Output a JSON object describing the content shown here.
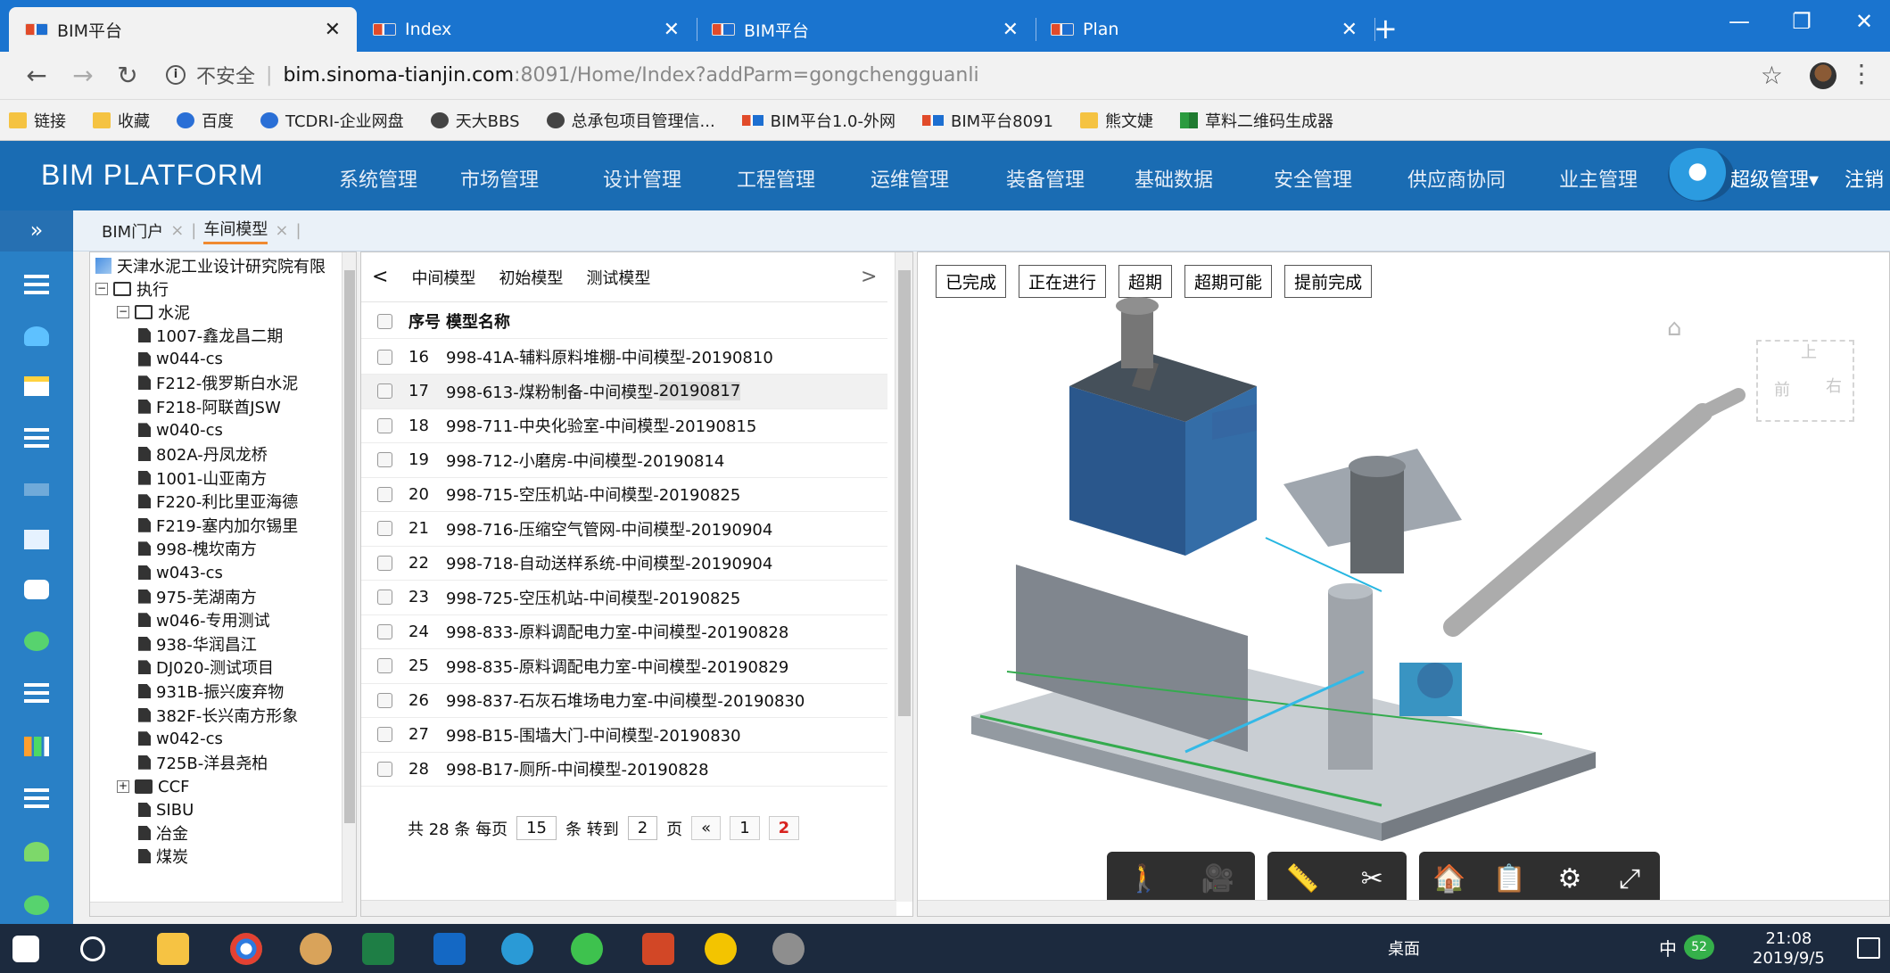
{
  "browser": {
    "tabs": [
      {
        "label": "BIM平台",
        "active": true
      },
      {
        "label": "Index",
        "active": false
      },
      {
        "label": "BIM平台",
        "active": false
      },
      {
        "label": "Plan",
        "active": false
      }
    ],
    "new_tab": "+",
    "window_controls": [
      "—",
      "❐",
      "✕"
    ],
    "address": {
      "security": "不安全",
      "host": "bim.sinoma-tianjin.com",
      "path": ":8091/Home/Index?addParm=gongchengguanli"
    },
    "bookmarks": [
      {
        "label": "链接",
        "icon": "folder-icon"
      },
      {
        "label": "收藏",
        "icon": "folder-icon"
      },
      {
        "label": "百度",
        "icon": "baidu-icon"
      },
      {
        "label": "TCDRI-企业网盘",
        "icon": "disk-icon"
      },
      {
        "label": "天大BBS",
        "icon": "globe-icon"
      },
      {
        "label": "总承包项目管理信...",
        "icon": "globe-icon"
      },
      {
        "label": "BIM平台1.0-外网",
        "icon": "bim-icon"
      },
      {
        "label": "BIM平台8091",
        "icon": "bim-icon"
      },
      {
        "label": "熊文婕",
        "icon": "folder-icon"
      },
      {
        "label": "草料二维码生成器",
        "icon": "qr-icon"
      }
    ]
  },
  "app": {
    "brand": "BIM PLATFORM",
    "nav": [
      "系统管理",
      "市场管理",
      "设计管理",
      "工程管理",
      "运维管理",
      "装备管理",
      "基础数据",
      "安全管理",
      "供应商协同",
      "业主管理"
    ],
    "user_label": "超级管理▾",
    "logout": "注销",
    "rail_toggle": "»",
    "crumbs": [
      "BIM门户",
      "车间模型"
    ]
  },
  "tree": {
    "root": "天津水泥工业设计研究院有限",
    "exec": "执行",
    "cement": "水泥",
    "projects": [
      "1007-鑫龙昌二期",
      "w044-cs",
      "F212-俄罗斯白水泥",
      "F218-阿联酋JSW",
      "w040-cs",
      "802A-丹凤龙桥",
      "1001-山亚南方",
      "F220-利比里亚海德",
      "F219-塞内加尔锡里",
      "998-槐坎南方",
      "w043-cs",
      "975-芜湖南方",
      "w046-专用测试",
      "938-华润昌江",
      "DJ020-测试项目",
      "931B-振兴废弃物",
      "382F-长兴南方形象",
      "w042-cs",
      "725B-洋县尧柏"
    ],
    "others": [
      "CCF",
      "SIBU",
      "冶金",
      "煤炭"
    ]
  },
  "list": {
    "subtabs": [
      "中间模型",
      "初始模型",
      "测试模型"
    ],
    "prev": "<",
    "next": ">",
    "header": {
      "no": "序号",
      "name": "模型名称"
    },
    "rows": [
      {
        "no": "16",
        "name": "998-41A-辅料原料堆棚-中间模型-20190810"
      },
      {
        "no": "17",
        "name": "998-613-煤粉制备-中间模型-",
        "hl": "20190817"
      },
      {
        "no": "18",
        "name": "998-711-中央化验室-中间模型-20190815"
      },
      {
        "no": "19",
        "name": "998-712-小磨房-中间模型-20190814"
      },
      {
        "no": "20",
        "name": "998-715-空压机站-中间模型-20190825"
      },
      {
        "no": "21",
        "name": "998-716-压缩空气管网-中间模型-20190904"
      },
      {
        "no": "22",
        "name": "998-718-自动送样系统-中间模型-20190904"
      },
      {
        "no": "23",
        "name": "998-725-空压机站-中间模型-20190825"
      },
      {
        "no": "24",
        "name": "998-833-原料调配电力室-中间模型-20190828"
      },
      {
        "no": "25",
        "name": "998-835-原料调配电力室-中间模型-20190829"
      },
      {
        "no": "26",
        "name": "998-837-石灰石堆场电力室-中间模型-20190830"
      },
      {
        "no": "27",
        "name": "998-B15-围墙大门-中间模型-20190830"
      },
      {
        "no": "28",
        "name": "998-B17-厕所-中间模型-20190828"
      }
    ],
    "pager": {
      "total_pre": "共 28 条 每页",
      "per_page": "15",
      "per_post": "条 转到",
      "goto": "2",
      "page_word": "页",
      "first": "«",
      "p1": "1",
      "p2": "2"
    }
  },
  "viewer": {
    "status_buttons": [
      "已完成",
      "正在进行",
      "超期",
      "超期可能",
      "提前完成"
    ],
    "cube_labels": {
      "top": "上",
      "front": "前",
      "right": "右"
    },
    "tools": [
      "🚶",
      "🎥",
      "📏",
      "✂",
      "🏠",
      "📋",
      "⚙",
      "⤢"
    ]
  },
  "taskbar": {
    "desktop": "桌面",
    "ime": "中",
    "badge": "52",
    "time": "21:08",
    "date": "2019/9/5"
  }
}
